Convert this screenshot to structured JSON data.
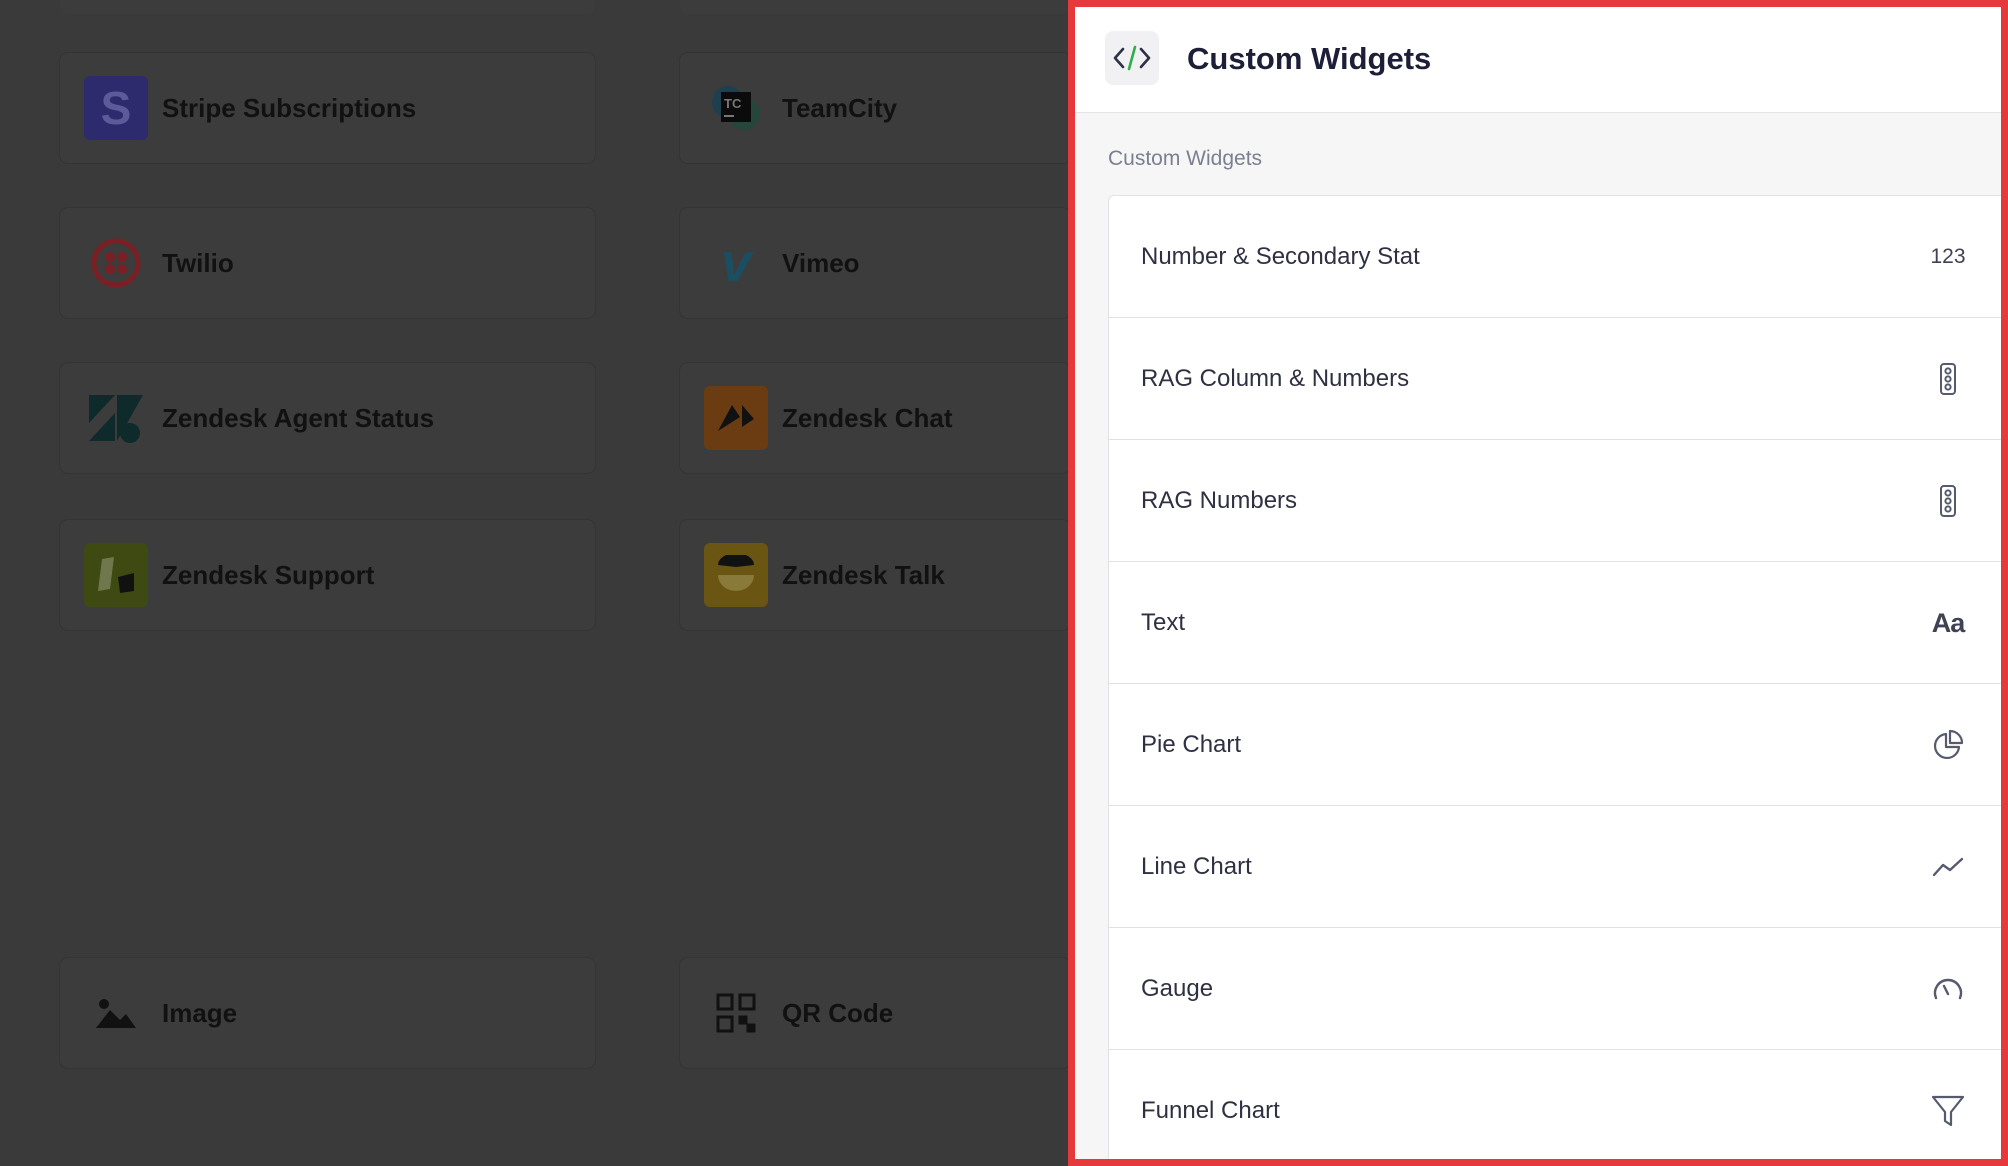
{
  "background": {
    "integrations": [
      {
        "name": "Stripe Subscriptions",
        "icon": "stripe-icon",
        "color": "#2e2a6e"
      },
      {
        "name": "TeamCity",
        "icon": "teamcity-icon",
        "color": "#1c1c1c"
      },
      {
        "name": "Twilio",
        "icon": "twilio-icon",
        "color": "#7a1f24"
      },
      {
        "name": "Vimeo",
        "icon": "vimeo-icon",
        "color": "#1a4f63"
      },
      {
        "name": "Zendesk Agent Status",
        "icon": "zendesk-icon",
        "color": "#0e2a2a"
      },
      {
        "name": "Zendesk Chat",
        "icon": "zendesk-chat-icon",
        "color": "#6b3c12"
      },
      {
        "name": "Zendesk Support",
        "icon": "zendesk-support-icon",
        "color": "#3f4a12"
      },
      {
        "name": "Zendesk Talk",
        "icon": "zendesk-talk-icon",
        "color": "#6a5612"
      },
      {
        "name": "Image",
        "icon": "image-icon",
        "color": "#111111"
      },
      {
        "name": "QR Code",
        "icon": "qr-code-icon",
        "color": "#111111"
      }
    ]
  },
  "panel": {
    "title": "Custom Widgets",
    "header_icon": "code-icon",
    "section_label": "Custom Widgets",
    "border_color": "#e5393b",
    "items": [
      {
        "label": "Number & Secondary Stat",
        "icon": "number-icon",
        "icon_text": "123"
      },
      {
        "label": "RAG Column & Numbers",
        "icon": "traffic-light-icon"
      },
      {
        "label": "RAG Numbers",
        "icon": "traffic-light-icon"
      },
      {
        "label": "Text",
        "icon": "text-icon",
        "icon_text": "Aa"
      },
      {
        "label": "Pie Chart",
        "icon": "pie-chart-icon"
      },
      {
        "label": "Line Chart",
        "icon": "line-chart-icon"
      },
      {
        "label": "Gauge",
        "icon": "gauge-icon"
      },
      {
        "label": "Funnel Chart",
        "icon": "funnel-icon"
      }
    ]
  }
}
